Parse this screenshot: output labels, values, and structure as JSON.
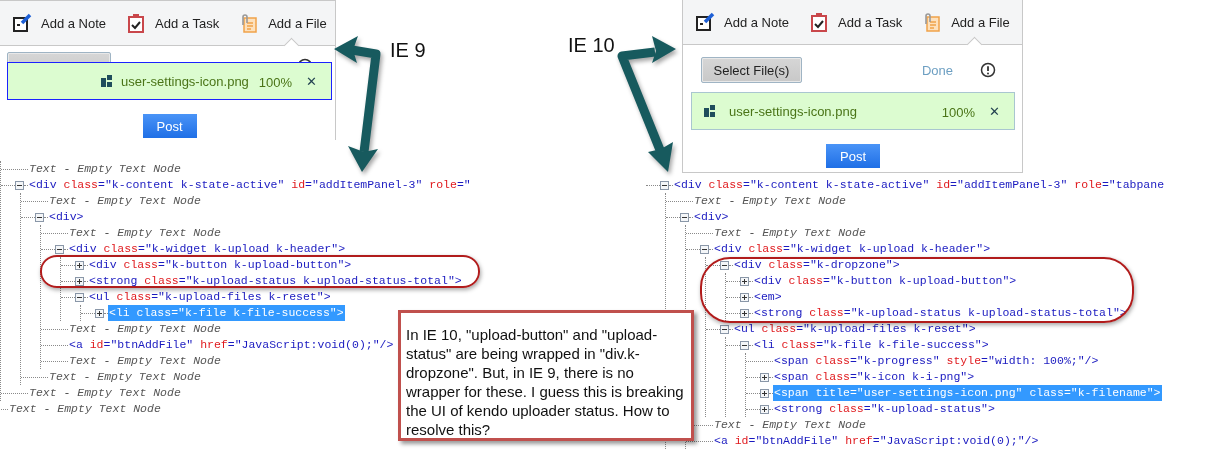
{
  "ie9": {
    "label": "IE 9",
    "widget": {
      "tabs": [
        {
          "kind": "note",
          "label": "Add a Note",
          "selected": false
        },
        {
          "kind": "task",
          "label": "Add a Task",
          "selected": false
        },
        {
          "kind": "file",
          "label": "Add a File",
          "selected": true
        }
      ],
      "header_collapsed": true,
      "files": [
        {
          "name": "user-settings-icon.png",
          "percent": "100%",
          "remove": "✕",
          "focused": true
        }
      ],
      "post_button": "Post"
    },
    "dom_tree": [
      {
        "kind": "group",
        "children": [
          {
            "kind": "text",
            "label": "Text - Empty Text Node",
            "selected": false
          },
          {
            "kind": "element",
            "label": "<div class=\"k-content k-state-active\" id=\"addItemPanel-3\" role=\"",
            "expanded": true,
            "selected": false,
            "children": [
              {
                "kind": "text",
                "label": "Text - Empty Text Node",
                "selected": false
              },
              {
                "kind": "element",
                "label": "<div>",
                "expanded": true,
                "selected": false,
                "children": [
                  {
                    "kind": "text",
                    "label": "Text - Empty Text Node",
                    "selected": false
                  },
                  {
                    "kind": "element",
                    "label": "<div class=\"k-widget k-upload k-header\">",
                    "expanded": true,
                    "selected": false,
                    "children": [
                      {
                        "kind": "element",
                        "label": "<div class=\"k-button k-upload-button\">",
                        "expanded": false,
                        "selected": false
                      },
                      {
                        "kind": "element",
                        "label": "<strong class=\"k-upload-status k-upload-status-total\">",
                        "expanded": false,
                        "selected": false
                      },
                      {
                        "kind": "element",
                        "label": "<ul class=\"k-upload-files k-reset\">",
                        "expanded": true,
                        "selected": false,
                        "children": [
                          {
                            "kind": "element",
                            "label": "<li class=\"k-file k-file-success\">",
                            "expanded": false,
                            "selected": true
                          }
                        ]
                      }
                    ]
                  },
                  {
                    "kind": "text",
                    "label": "Text - Empty Text Node",
                    "selected": false
                  },
                  {
                    "kind": "leaf",
                    "label": "<a id=\"btnAddFile\" href=\"JavaScript:void(0);\"/>",
                    "selected": false
                  },
                  {
                    "kind": "text",
                    "label": "Text - Empty Text Node",
                    "selected": false
                  }
                ]
              },
              {
                "kind": "text",
                "label": "Text - Empty Text Node",
                "selected": false
              }
            ]
          },
          {
            "kind": "text",
            "label": "Text - Empty Text Node",
            "selected": false
          }
        ]
      },
      {
        "kind": "text",
        "label": "Text - Empty Text Node",
        "selected": false
      }
    ]
  },
  "ie10": {
    "label": "IE 10",
    "widget": {
      "tabs": [
        {
          "kind": "note",
          "label": "Add a Note",
          "selected": false
        },
        {
          "kind": "task",
          "label": "Add a Task",
          "selected": false
        },
        {
          "kind": "file",
          "label": "Add a File",
          "selected": true
        }
      ],
      "header_collapsed": false,
      "select_button": "Select File(s)",
      "done_link": "Done",
      "files": [
        {
          "name": "user-settings-icon.png",
          "percent": "100%",
          "remove": "✕",
          "focused": false
        }
      ],
      "post_button": "Post"
    },
    "dom_tree": [
      {
        "kind": "element",
        "label": "<div class=\"k-content k-state-active\" id=\"addItemPanel-3\" role=\"tabpane",
        "expanded": true,
        "selected": false,
        "children": [
          {
            "kind": "text",
            "label": "Text - Empty Text Node",
            "selected": false
          },
          {
            "kind": "element",
            "label": "<div>",
            "expanded": true,
            "selected": false,
            "children": [
              {
                "kind": "text",
                "label": "Text - Empty Text Node",
                "selected": false
              },
              {
                "kind": "element",
                "label": "<div class=\"k-widget k-upload k-header\">",
                "expanded": true,
                "selected": false,
                "children": [
                  {
                    "kind": "element",
                    "label": "<div class=\"k-dropzone\">",
                    "expanded": true,
                    "selected": false,
                    "children": [
                      {
                        "kind": "element",
                        "label": "<div class=\"k-button k-upload-button\">",
                        "expanded": false,
                        "selected": false
                      },
                      {
                        "kind": "element",
                        "label": "<em>",
                        "expanded": false,
                        "selected": false
                      },
                      {
                        "kind": "element",
                        "label": "<strong class=\"k-upload-status k-upload-status-total\">",
                        "expanded": false,
                        "selected": false
                      }
                    ]
                  },
                  {
                    "kind": "element",
                    "label": "<ul class=\"k-upload-files k-reset\">",
                    "expanded": true,
                    "selected": false,
                    "children": [
                      {
                        "kind": "element",
                        "label": "<li class=\"k-file k-file-success\">",
                        "expanded": true,
                        "selected": false,
                        "children": [
                          {
                            "kind": "leaf",
                            "label": "<span class=\"k-progress\" style=\"width: 100%;\"/>",
                            "selected": false
                          },
                          {
                            "kind": "element",
                            "label": "<span class=\"k-icon k-i-png\">",
                            "expanded": false,
                            "selected": false
                          },
                          {
                            "kind": "element",
                            "label": "<span title=\"user-settings-icon.png\" class=\"k-filename\">",
                            "expanded": false,
                            "selected": true
                          },
                          {
                            "kind": "element",
                            "label": "<strong class=\"k-upload-status\">",
                            "expanded": false,
                            "selected": false
                          }
                        ]
                      }
                    ]
                  }
                ]
              },
              {
                "kind": "text",
                "label": "Text - Empty Text Node",
                "selected": false
              },
              {
                "kind": "leaf",
                "label": "<a id=\"btnAddFile\" href=\"JavaScript:void(0);\"/>",
                "selected": false
              }
            ]
          }
        ]
      }
    ]
  },
  "callout": "In IE 10, \"upload-button\" and \"upload-status\" are being wrapped in \"div.k-dropzone\". But, in IE 9, there is no wrapper for these. I guess this is breaking the UI of kendo uploader status. How to resolve this?"
}
